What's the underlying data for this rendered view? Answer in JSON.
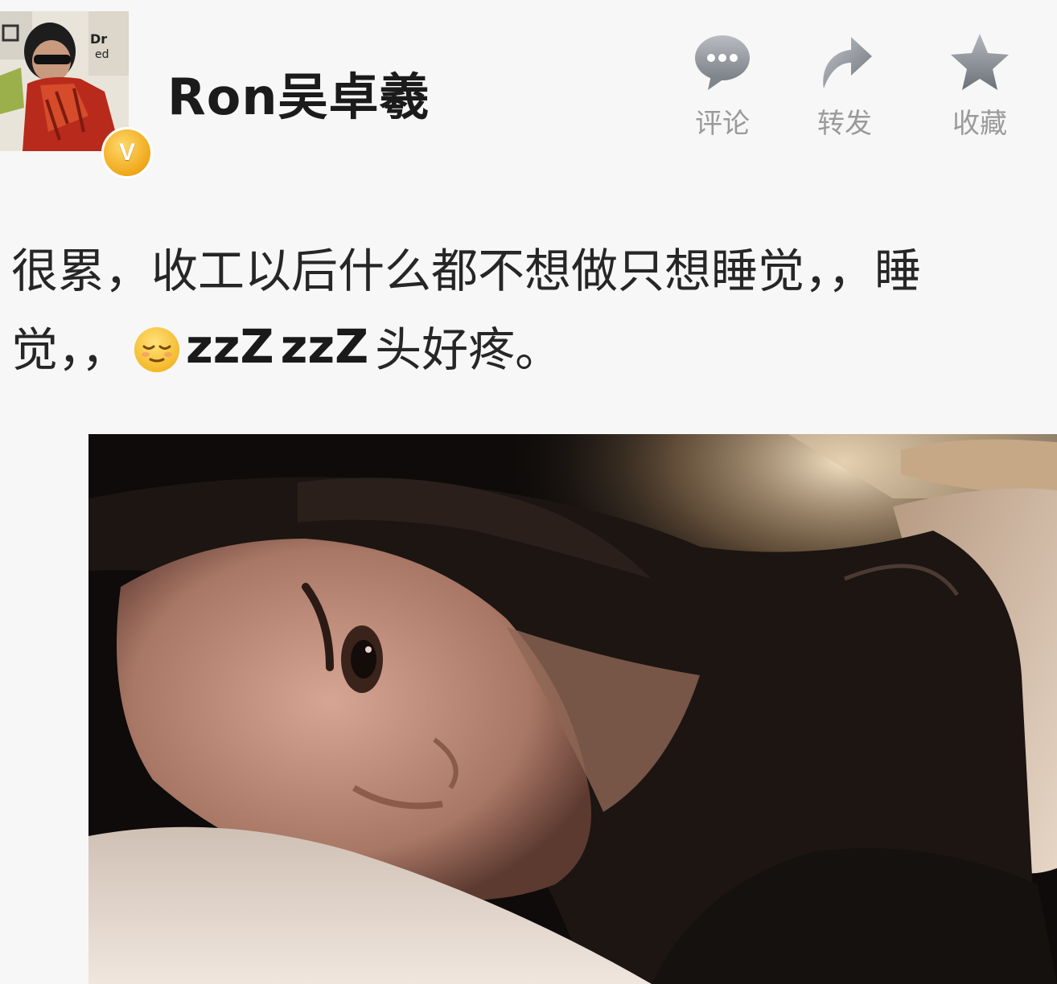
{
  "header": {
    "username": "Ron吴卓羲",
    "avatar_icon": "profile-photo",
    "verified_badge": "V"
  },
  "actions": [
    {
      "label": "评论",
      "icon": "comment-bubble-icon"
    },
    {
      "label": "转发",
      "icon": "forward-arrow-icon"
    },
    {
      "label": "收藏",
      "icon": "star-icon"
    }
  ],
  "post": {
    "line1": "很累，收工以后什么都不想做只想睡觉，，睡",
    "line2_before": "觉，，",
    "emoji": "relieved-face-emoji",
    "zzz_1": "zzZ",
    "zzz_2": "zzZ",
    "line2_after": "头好疼。"
  },
  "photo": {
    "subject": "woman-lying-in-bed-photo"
  },
  "colors": {
    "background": "#f7f7f8",
    "text": "#262626",
    "action_gray": "#9a9a9a",
    "badge_gold": "#f0a81a"
  }
}
